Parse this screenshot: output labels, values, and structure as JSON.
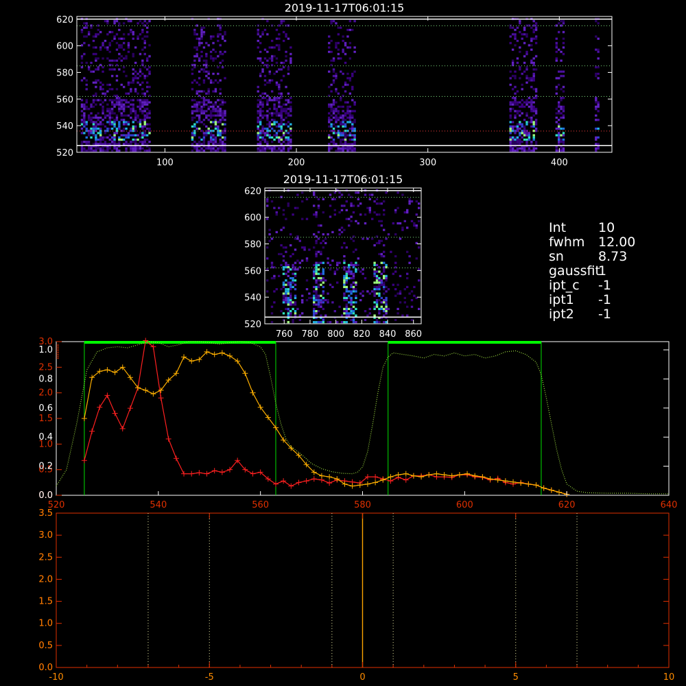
{
  "colors": {
    "background": "#000000",
    "axes": "#ffffff",
    "spectrum_red": "#ff2020",
    "spectrum_orange": "#ffb000",
    "filter_curve": "#a0e040",
    "band_marker": "#00ff00",
    "band_edge": "#00e000",
    "orange_axes": "#ff8c00",
    "red_axes": "#e03000",
    "line_marker": "#ffa500",
    "dotted_lines": "#e8e8a0"
  },
  "info_panel": [
    {
      "key": "Int",
      "value": "10"
    },
    {
      "key": "fwhm",
      "value": "12.00"
    },
    {
      "key": "sn",
      "value": "8.73"
    },
    {
      "key": "gaussfit",
      "value": "1"
    },
    {
      "key": "ipt_c",
      "value": "-1"
    },
    {
      "key": "ipt1",
      "value": "-1"
    },
    {
      "key": "ipt2",
      "value": "-1"
    }
  ],
  "chart_data": [
    {
      "id": "full_image",
      "type": "heatmap",
      "title": "2019-11-17T06:01:15",
      "xlim": [
        33,
        440
      ],
      "ylim": [
        520,
        622
      ],
      "xticks": [
        100,
        200,
        300,
        400
      ],
      "yticks": [
        520,
        540,
        560,
        580,
        600,
        620
      ],
      "signal_columns": [
        [
          36,
          88
        ],
        [
          120,
          146
        ],
        [
          170,
          195
        ],
        [
          224,
          244
        ],
        [
          362,
          383
        ],
        [
          397,
          403
        ],
        [
          427,
          430
        ]
      ],
      "solid_rows": [
        525,
        620
      ],
      "dotted_rows": [
        536,
        562,
        585,
        615
      ]
    },
    {
      "id": "zoom_image",
      "type": "heatmap",
      "title": "2019-11-17T06:01:15",
      "xlim": [
        745,
        866
      ],
      "ylim": [
        520,
        622
      ],
      "xticks": [
        760,
        780,
        800,
        820,
        840,
        860
      ],
      "yticks": [
        520,
        540,
        560,
        580,
        600,
        620
      ],
      "bright_columns": [
        763,
        786,
        810,
        834
      ],
      "solid_rows": [
        525,
        620
      ],
      "dotted_rows": [
        562,
        585,
        615
      ]
    },
    {
      "id": "spectrum",
      "type": "line",
      "xlim": [
        520,
        640
      ],
      "xticks": [
        520,
        540,
        560,
        580,
        600,
        620,
        640
      ],
      "ylim": [
        0,
        3.0
      ],
      "yticks_red": [
        "0.0",
        "0.5",
        "1.0",
        "1.5",
        "2.0",
        "2.5",
        "3.0"
      ],
      "yticks_white": [
        "0.0",
        "0.2",
        "0.4",
        "0.6",
        "0.8",
        "1.0"
      ],
      "bands": [
        [
          525.5,
          563
        ],
        [
          585,
          615
        ]
      ],
      "series": [
        {
          "color_key": "spectrum_red",
          "x": [
            525.5,
            527,
            528.5,
            530,
            531.5,
            533,
            534.5,
            536,
            537.5,
            539,
            540.5,
            542,
            543.5,
            545,
            546.5,
            548,
            549.5,
            551,
            552.5,
            554,
            555.5,
            557,
            558.5,
            560,
            561.5,
            563,
            564.5,
            566,
            567.5,
            569,
            570.5,
            572,
            573.5,
            575,
            576.5,
            578,
            579.5,
            581,
            582.5,
            584,
            585.5,
            587,
            588.5,
            590,
            591.5,
            593,
            594.5,
            596,
            597.5,
            599,
            600.5,
            602,
            603.5,
            605,
            606.5,
            608,
            609.5,
            611,
            612.5,
            614,
            615.5,
            617,
            618.5,
            620
          ],
          "y": [
            0.68,
            1.25,
            1.72,
            1.95,
            1.6,
            1.3,
            1.7,
            2.1,
            3.02,
            2.9,
            1.9,
            1.1,
            0.72,
            0.42,
            0.42,
            0.44,
            0.42,
            0.48,
            0.45,
            0.5,
            0.68,
            0.5,
            0.42,
            0.45,
            0.32,
            0.22,
            0.28,
            0.18,
            0.25,
            0.28,
            0.32,
            0.3,
            0.24,
            0.3,
            0.28,
            0.26,
            0.24,
            0.36,
            0.36,
            0.32,
            0.28,
            0.35,
            0.3,
            0.38,
            0.38,
            0.4,
            0.36,
            0.36,
            0.35,
            0.4,
            0.4,
            0.36,
            0.35,
            0.3,
            0.33,
            0.25,
            0.22,
            0.25,
            0.22,
            0.2,
            0.14,
            0.1,
            0.06,
            0.02
          ]
        },
        {
          "color_key": "spectrum_orange",
          "x": [
            525.5,
            527,
            528.5,
            530,
            531.5,
            533,
            534.5,
            536,
            537.5,
            539,
            540.5,
            542,
            543.5,
            545,
            546.5,
            548,
            549.5,
            551,
            552.5,
            554,
            555.5,
            557,
            558.5,
            560,
            561.5,
            563,
            564.5,
            566,
            567.5,
            569,
            570.5,
            572,
            573.5,
            575,
            576.5,
            578,
            579.5,
            581,
            582.5,
            584,
            585.5,
            587,
            588.5,
            590,
            591.5,
            593,
            594.5,
            596,
            597.5,
            599,
            600.5,
            602,
            603.5,
            605,
            606.5,
            608,
            609.5,
            611,
            612.5,
            614,
            615.5,
            617,
            618.5,
            620
          ],
          "y": [
            1.5,
            2.3,
            2.42,
            2.45,
            2.4,
            2.5,
            2.3,
            2.1,
            2.05,
            1.98,
            2.05,
            2.25,
            2.38,
            2.7,
            2.62,
            2.65,
            2.8,
            2.75,
            2.78,
            2.72,
            2.62,
            2.38,
            2.0,
            1.72,
            1.52,
            1.32,
            1.08,
            0.92,
            0.78,
            0.6,
            0.45,
            0.38,
            0.36,
            0.32,
            0.22,
            0.18,
            0.2,
            0.22,
            0.25,
            0.3,
            0.36,
            0.4,
            0.42,
            0.38,
            0.36,
            0.4,
            0.42,
            0.4,
            0.38,
            0.4,
            0.42,
            0.38,
            0.36,
            0.32,
            0.3,
            0.28,
            0.26,
            0.24,
            0.22,
            0.2,
            0.14,
            0.1,
            0.06,
            0.02
          ]
        },
        {
          "color_key": "filter_curve",
          "x": [
            520,
            522,
            524,
            526,
            528,
            530,
            532,
            534,
            536,
            538,
            540,
            542,
            544,
            546,
            548,
            550,
            552,
            554,
            556,
            558,
            560,
            561,
            562,
            563,
            564,
            565,
            566,
            568,
            570,
            572,
            574,
            576,
            578,
            579,
            580,
            581,
            582,
            583,
            584,
            585,
            586,
            588,
            590,
            592,
            594,
            596,
            598,
            600,
            602,
            604,
            606,
            608,
            610,
            612,
            614,
            615,
            616,
            617,
            618,
            619,
            620,
            622,
            624,
            628,
            632,
            636,
            640
          ],
          "y": [
            0.18,
            0.5,
            1.4,
            2.45,
            2.8,
            2.88,
            2.9,
            2.88,
            2.94,
            3.0,
            2.98,
            2.9,
            2.94,
            3.0,
            3.0,
            2.98,
            2.95,
            2.98,
            3.0,
            2.98,
            2.9,
            2.75,
            2.3,
            1.8,
            1.4,
            1.1,
            0.95,
            0.8,
            0.62,
            0.52,
            0.46,
            0.43,
            0.42,
            0.45,
            0.55,
            0.85,
            1.4,
            2.0,
            2.5,
            2.7,
            2.78,
            2.75,
            2.72,
            2.68,
            2.75,
            2.72,
            2.78,
            2.72,
            2.75,
            2.68,
            2.72,
            2.8,
            2.82,
            2.75,
            2.6,
            2.35,
            1.9,
            1.4,
            0.9,
            0.5,
            0.22,
            0.08,
            0.05,
            0.04,
            0.04,
            0.03,
            0.03
          ]
        }
      ]
    },
    {
      "id": "velocity_panel",
      "type": "line",
      "xlim": [
        -10,
        10
      ],
      "xticks": [
        "-10",
        "-5",
        "0",
        "5",
        "10"
      ],
      "ylim": [
        0,
        3.5
      ],
      "yticks_red": [
        "0.0",
        "0.5",
        "1.0",
        "1.5",
        "2.0",
        "2.5",
        "3.0",
        "3.5"
      ],
      "yticks_orange": [
        "0.0",
        "0.5",
        "1.0",
        "1.5",
        "2.0",
        "2.5",
        "3.0",
        "3.5"
      ],
      "marker_x": 0,
      "dotted_x": [
        -7,
        -5,
        -1,
        1,
        5,
        7
      ]
    }
  ]
}
